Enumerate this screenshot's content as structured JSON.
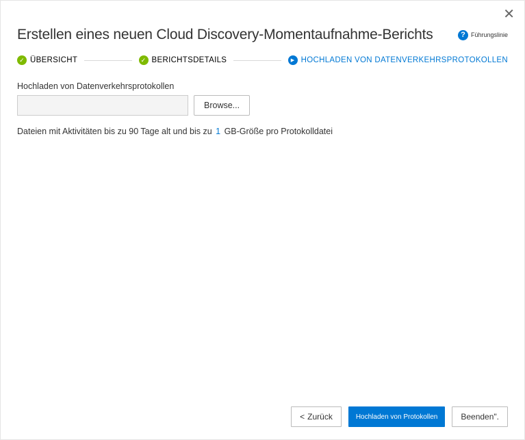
{
  "header": {
    "title": "Erstellen eines neuen Cloud Discovery-Momentaufnahme-Berichts",
    "help_label": "Führungslinie"
  },
  "steps": {
    "s1": "ÜBERSICHT",
    "s2": "BERICHTSDETAILS",
    "s3": "HOCHLADEN VON DATENVERKEHRSPROTOKOLLEN"
  },
  "content": {
    "upload_label": "Hochladen von Datenverkehrsprotokollen",
    "browse_label": "Browse...",
    "hint_pre": "Dateien mit Aktivitäten bis zu 90 Tage alt und bis zu",
    "hint_num": "1",
    "hint_post": "GB-Größe pro Protokolldatei"
  },
  "footer": {
    "back_label": "Zurück",
    "upload_label": "Hochladen von Protokollen",
    "finish_label": "Beenden\"."
  }
}
